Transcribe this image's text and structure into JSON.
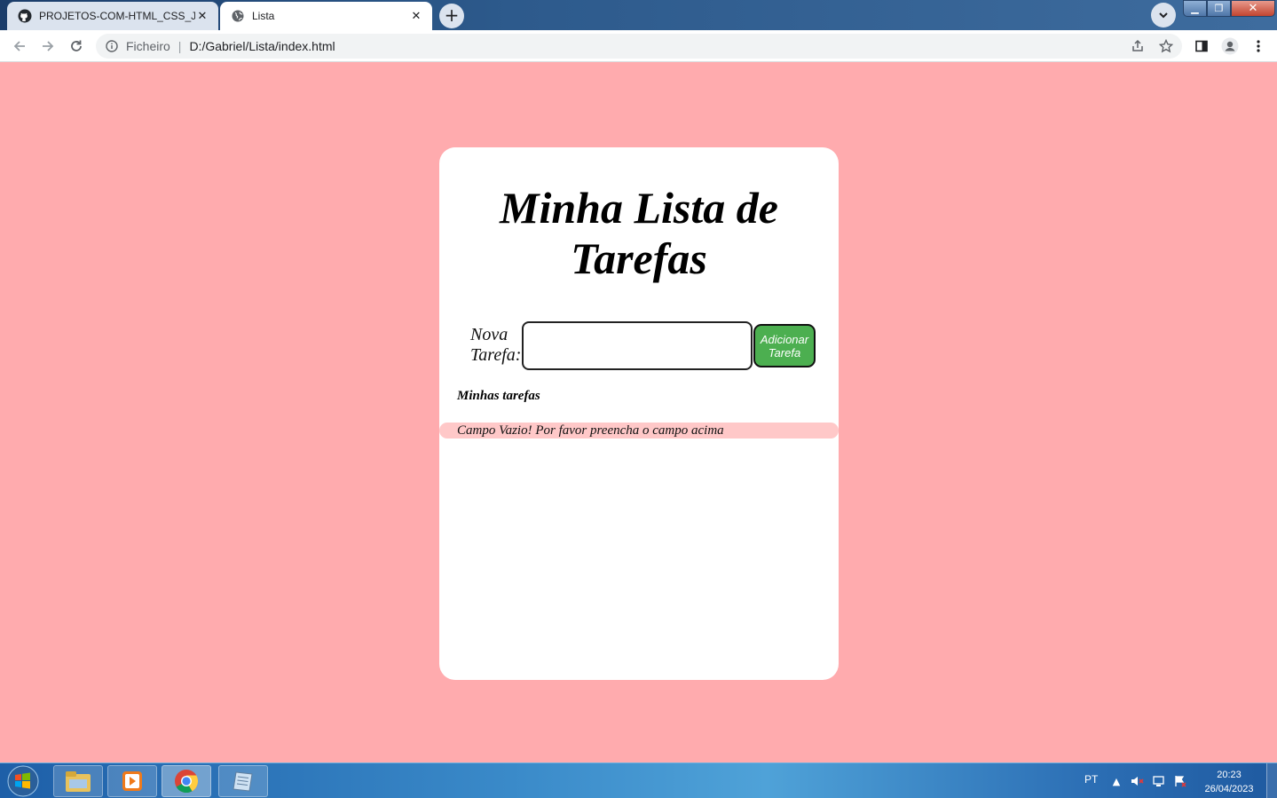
{
  "browser": {
    "tabs": [
      {
        "title": "PROJETOS-COM-HTML_CSS_JAV",
        "icon": "github-icon",
        "active": false
      },
      {
        "title": "Lista",
        "icon": "globe-icon",
        "active": true
      }
    ],
    "address": {
      "scheme_label": "Ficheiro",
      "url": "D:/Gabriel/Lista/index.html"
    }
  },
  "page": {
    "title": "Minha Lista de Tarefas",
    "input_label": "Nova Tarefa:",
    "input_value": "",
    "add_button_label": "Adicionar Tarefa",
    "tasks_heading": "Minhas tarefas",
    "error_message": "Campo Vazio! Por favor preencha o campo acima",
    "colors": {
      "background": "#ffabae",
      "card": "#ffffff",
      "button": "#4caf50",
      "error_band": "#ffc8c8"
    }
  },
  "taskbar": {
    "apps": [
      "windows-explorer-icon",
      "media-player-icon",
      "chrome-icon",
      "notepad-icon"
    ],
    "language": "PT",
    "time": "20:23",
    "date": "26/04/2023"
  }
}
